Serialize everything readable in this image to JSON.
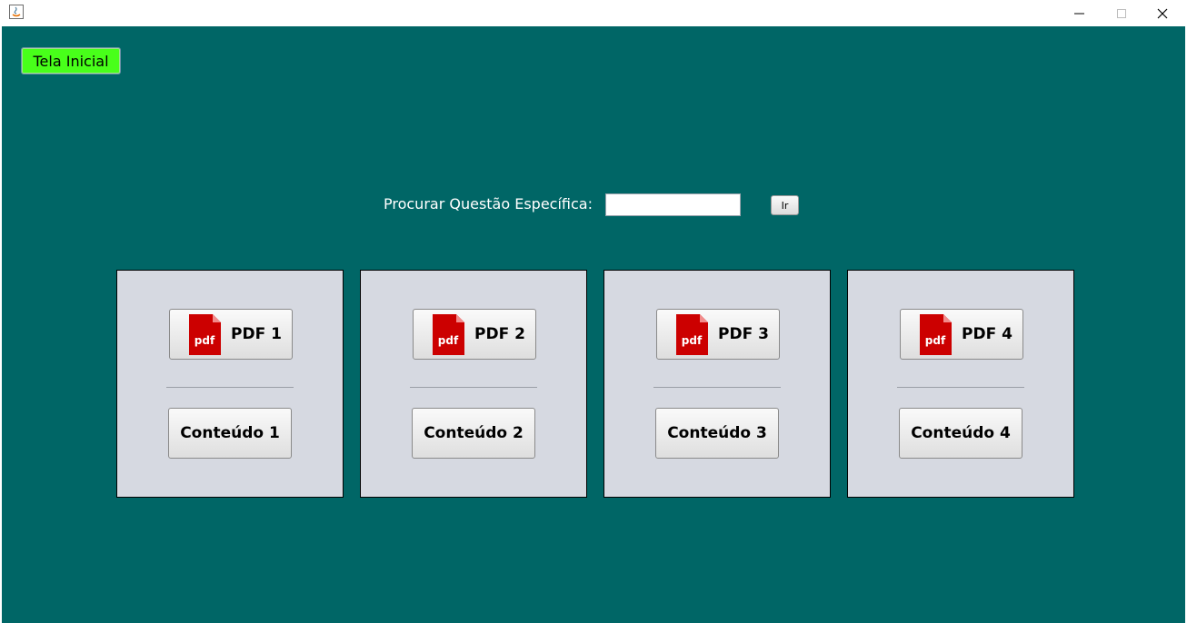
{
  "window": {
    "minimize_glyph": "—",
    "close_glyph": "✕"
  },
  "home_button": "Tela Inicial",
  "search": {
    "label": "Procurar Questão Específica:",
    "value": "",
    "go_label": "Ir"
  },
  "pdf_icon_text": "pdf",
  "cards": [
    {
      "pdf_label": "PDF 1",
      "content_label": "Conteúdo 1"
    },
    {
      "pdf_label": "PDF 2",
      "content_label": "Conteúdo 2"
    },
    {
      "pdf_label": "PDF 3",
      "content_label": "Conteúdo 3"
    },
    {
      "pdf_label": "PDF 4",
      "content_label": "Conteúdo 4"
    }
  ],
  "colors": {
    "background": "#006666",
    "home_button": "#48ff1a",
    "card": "#d6d9e1",
    "pdf_red": "#cc0000"
  }
}
